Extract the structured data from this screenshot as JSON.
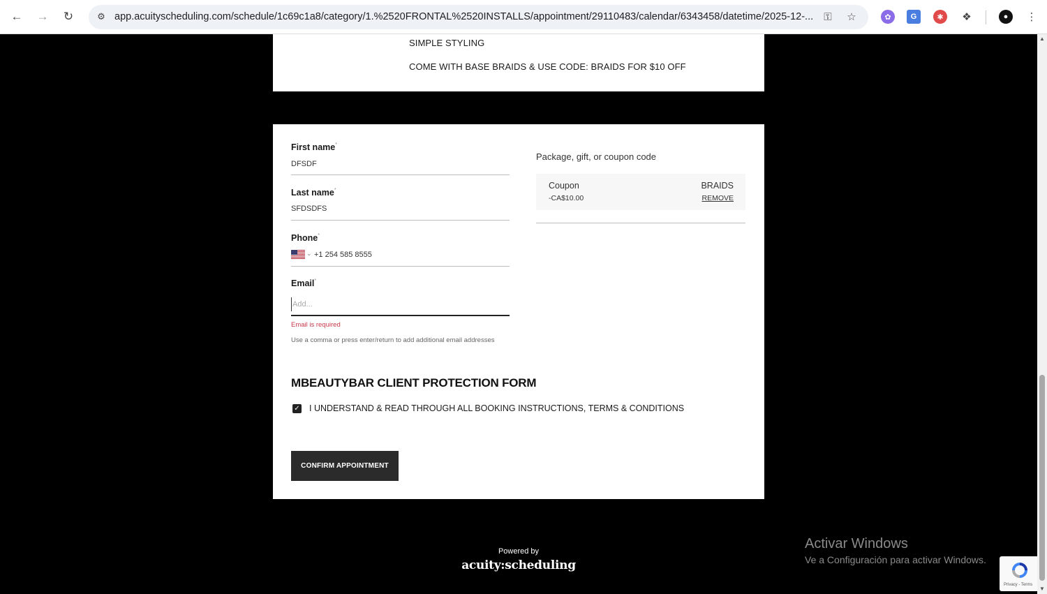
{
  "browser": {
    "url": "app.acuityscheduling.com/schedule/1c69c1a8/category/1.%2520FRONTAL%2520INSTALLS/appointment/29110483/calendar/6343458/datetime/2025-12-...",
    "icons": {
      "back": "back-arrow-icon",
      "forward": "forward-arrow-icon",
      "reload": "reload-icon",
      "site_info": "tune-icon",
      "password": "key-icon",
      "bookmark": "star-icon",
      "extensions": "puzzle-icon",
      "menu": "kebab-menu-icon"
    }
  },
  "top_card": {
    "line1": "SIMPLE STYLING",
    "line2": "COME WITH BASE BRAIDS & USE CODE: BRAIDS FOR $10 OFF"
  },
  "form": {
    "first_name": {
      "label": "First name",
      "required_mark": "*",
      "value": "DFSDF"
    },
    "last_name": {
      "label": "Last name",
      "required_mark": "*",
      "value": "SFDSDFS"
    },
    "phone": {
      "label": "Phone",
      "required_mark": "*",
      "value": "+1 254 585 8555",
      "country": "US"
    },
    "email": {
      "label": "Email",
      "required_mark": "*",
      "placeholder": "Add...",
      "error": "Email is required",
      "hint": "Use a comma or press enter/return to add additional email addresses"
    },
    "protection": {
      "title": "MBEAUTYBAR CLIENT PROTECTION FORM",
      "checkbox_label": "I UNDERSTAND & READ THROUGH ALL BOOKING INSTRUCTIONS, TERMS & CONDITIONS",
      "checked": true
    },
    "confirm_label": "CONFIRM APPOINTMENT"
  },
  "coupon": {
    "heading": "Package, gift, or coupon code",
    "type": "Coupon",
    "amount": "-CA$10.00",
    "code": "BRAIDS",
    "remove_label": "REMOVE"
  },
  "footer": {
    "powered_by": "Powered by",
    "brand": "acuity:scheduling"
  },
  "watermark": {
    "title": "Activar Windows",
    "subtitle": "Ve a Configuración para activar Windows."
  },
  "recaptcha": {
    "text": "Privacy - Terms"
  },
  "colors": {
    "error": "#c8374a",
    "button": "#2b2b2b",
    "page_bg": "#000000"
  }
}
